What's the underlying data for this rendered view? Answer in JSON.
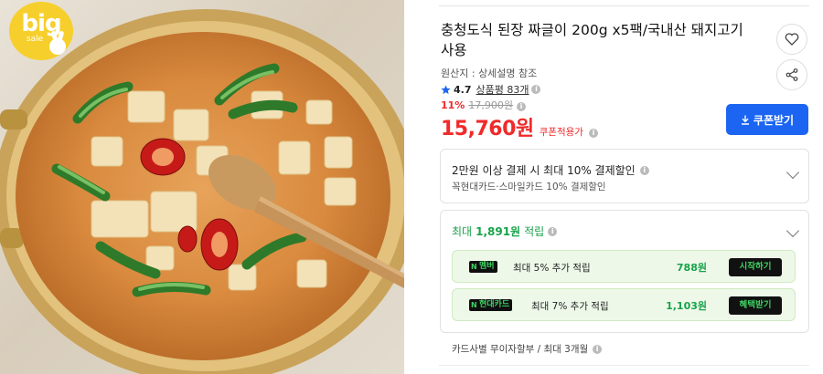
{
  "badge": {
    "big": "big",
    "sale": "sale"
  },
  "product": {
    "title": "충청도식 된장 짜글이 200g x5팩/국내산 돼지고기 사용",
    "origin_label": "원산지 :",
    "origin_value": "상세설명 참조",
    "rating": "4.7",
    "reviews": "상품평 83개",
    "discount": "11%",
    "original_price": "17,900원",
    "price": "15,760원",
    "coupon_note": "쿠폰적용가",
    "coupon_button": "쿠폰받기"
  },
  "payment_box": {
    "line1": "2만원 이상 결제 시 최대 10% 결제할인",
    "line2": "꼭현대카드·스마일카드 10% 결제할인"
  },
  "points_box": {
    "label": "최대",
    "amount": "1,891원",
    "suffix": "적립",
    "offers": [
      {
        "tag": "멤버",
        "desc": "최대 5% 추가 적립",
        "points": "788원",
        "action": "시작하기"
      },
      {
        "tag": "현대카드",
        "desc": "최대 7% 추가 적립",
        "points": "1,103원",
        "action": "혜택받기"
      }
    ]
  },
  "installment": "카드사별 무이자할부 / 최대 3개월",
  "colors": {
    "accent_blue": "#1c65f2",
    "price_red": "#f02a2a",
    "points_green": "#17a34a"
  },
  "icons": [
    "heart-icon",
    "share-icon",
    "star-icon",
    "download-icon",
    "info-icon",
    "chevron-down-icon"
  ]
}
